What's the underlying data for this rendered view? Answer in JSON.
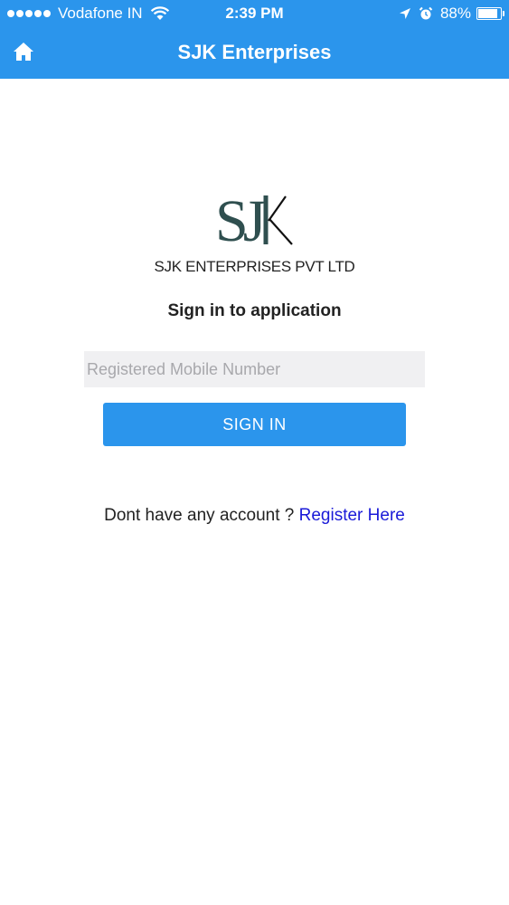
{
  "status_bar": {
    "carrier": "Vodafone IN",
    "time": "2:39 PM",
    "battery_percent": "88%",
    "battery_level": 0.88,
    "icons": [
      "signal-dots-icon",
      "wifi-icon",
      "location-arrow-icon",
      "alarm-icon",
      "battery-icon"
    ]
  },
  "app_bar": {
    "title": "SJK Enterprises",
    "home_icon": "home-icon",
    "color": "#2b95ec"
  },
  "logo": {
    "mark_text": "SJK",
    "company_name": "SJK ENTERPRISES PVT LTD",
    "mark_color": "#2f4f4f"
  },
  "form": {
    "heading": "Sign in to application",
    "mobile_field": {
      "value": "",
      "placeholder": "Registered Mobile Number"
    },
    "signin_label": "SIGN IN"
  },
  "register": {
    "prompt": "Dont have any account ? ",
    "link_label": "Register Here",
    "link_color": "#1a1ad8"
  }
}
